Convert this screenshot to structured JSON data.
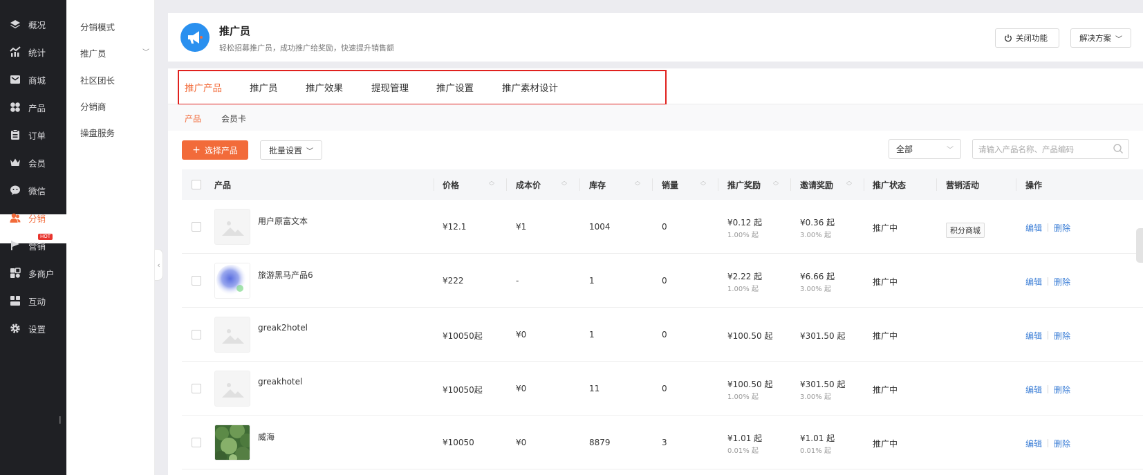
{
  "nav": {
    "items": [
      {
        "label": "概况",
        "icon": "layers-icon"
      },
      {
        "label": "统计",
        "icon": "chart-icon"
      },
      {
        "label": "商城",
        "icon": "mail-icon"
      },
      {
        "label": "产品",
        "icon": "grid-icon"
      },
      {
        "label": "订单",
        "icon": "clipboard-icon"
      },
      {
        "label": "会员",
        "icon": "crown-icon"
      },
      {
        "label": "微信",
        "icon": "wechat-icon"
      },
      {
        "label": "分销",
        "icon": "users-icon"
      },
      {
        "label": "营销",
        "icon": "flag-icon",
        "badge": "HOT"
      },
      {
        "label": "多商户",
        "icon": "store-icon"
      },
      {
        "label": "互动",
        "icon": "interact-icon"
      },
      {
        "label": "设置",
        "icon": "gear-icon"
      }
    ],
    "active": "分销",
    "collapse_mark": "|",
    "accent": "#f26b3a"
  },
  "subnav": {
    "items": [
      "分销模式",
      "推广员",
      "社区团长",
      "分销商",
      "操盘服务"
    ],
    "collapse_glyph": "‹"
  },
  "header": {
    "title": "推广员",
    "subtitle": "轻松招募推广员，成功推广给奖励，快速提升销售额",
    "close_label": "关闭功能",
    "solution_label": "解决方案"
  },
  "tabs": [
    "推广产品",
    "推广员",
    "推广效果",
    "提现管理",
    "推广设置",
    "推广素材设计"
  ],
  "active_tab": "推广产品",
  "subtabs": [
    "产品",
    "会员卡"
  ],
  "toolbar": {
    "add_label": "选择产品",
    "batch_label": "批量设置",
    "filter_value": "全部",
    "search_placeholder": "请输入产品名称、产品编码"
  },
  "table": {
    "columns": [
      "产品",
      "价格",
      "成本价",
      "库存",
      "销量",
      "推广奖励",
      "邀请奖励",
      "推广状态",
      "营销活动",
      "操作"
    ],
    "actions": {
      "edit": "编辑",
      "delete": "删除"
    },
    "rows": [
      {
        "name": "用户原富文本",
        "price": "¥12.1",
        "cost": "¥1",
        "stock": "1004",
        "sales": "0",
        "promo": "¥0.12 起",
        "promo_rate": "1.00% 起",
        "invite": "¥0.36 起",
        "invite_rate": "3.00% 起",
        "status": "推广中",
        "activity": "积分商城",
        "image": "placeholder"
      },
      {
        "name": "旅游黑马产品6",
        "price": "¥222",
        "cost": "-",
        "stock": "1",
        "sales": "0",
        "promo": "¥2.22 起",
        "promo_rate": "1.00% 起",
        "invite": "¥6.66 起",
        "invite_rate": "3.00% 起",
        "status": "推广中",
        "activity": "",
        "image": "blurred"
      },
      {
        "name": "greak2hotel",
        "price": "¥10050起",
        "cost": "¥0",
        "stock": "1",
        "sales": "0",
        "promo": "¥100.50 起",
        "promo_rate": "",
        "invite": "¥301.50 起",
        "invite_rate": "",
        "status": "推广中",
        "activity": "",
        "image": "placeholder"
      },
      {
        "name": "greakhotel",
        "price": "¥10050起",
        "cost": "¥0",
        "stock": "11",
        "sales": "0",
        "promo": "¥100.50 起",
        "promo_rate": "1.00% 起",
        "invite": "¥301.50 起",
        "invite_rate": "3.00% 起",
        "status": "推广中",
        "activity": "",
        "image": "placeholder"
      },
      {
        "name": "威海",
        "price": "¥10050",
        "cost": "¥0",
        "stock": "8879",
        "sales": "3",
        "promo": "¥1.01 起",
        "promo_rate": "0.01% 起",
        "invite": "¥1.01 起",
        "invite_rate": "0.01% 起",
        "status": "推广中",
        "activity": "",
        "image": "forest"
      }
    ]
  }
}
